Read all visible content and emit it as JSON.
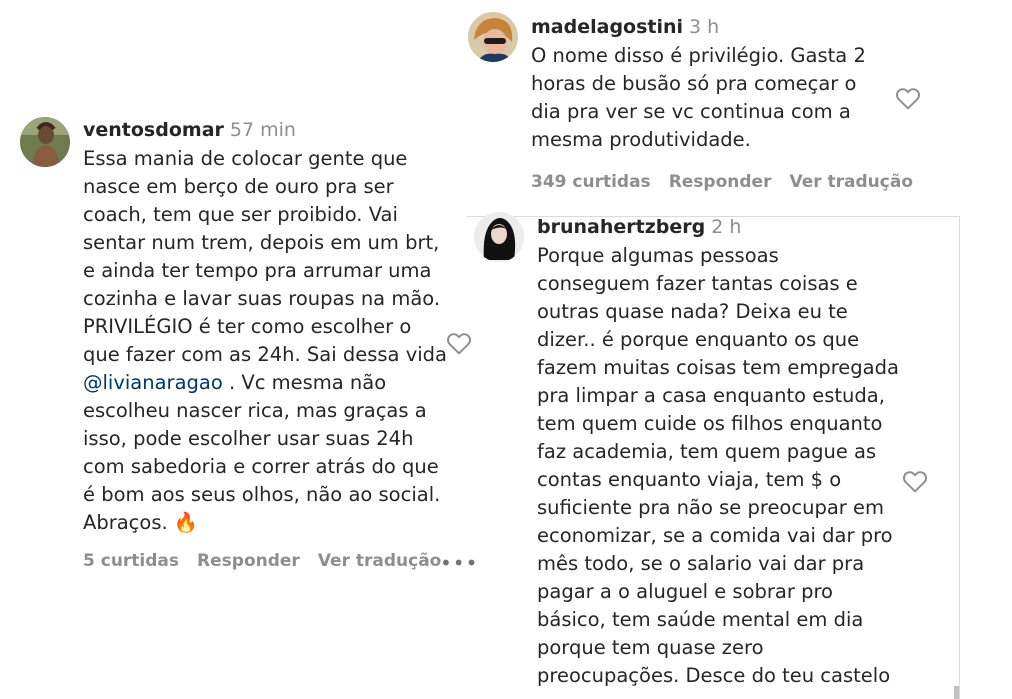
{
  "comments": [
    {
      "username": "ventosdomar",
      "time": "57 min",
      "text_before": "Essa mania de colocar gente que\nnasce em berço de ouro pra ser\ncoach, tem que ser proibido. Vai\nsentar num trem, depois em um brt,\ne ainda ter tempo pra arrumar uma\ncozinha e lavar suas roupas na mão.\nPRIVILÉGIO é ter como escolher o\nque fazer com as 24h. Sai dessa vida\n",
      "mention": "@livianaragao",
      "text_after": " . Vc mesma não\nescolheu nascer rica, mas graças a\nisso, pode escolher usar suas 24h\ncom sabedoria e correr atrás do que\né bom aos seus olhos, não ao social.\nAbraços. 🔥",
      "likes": "5 curtidas",
      "reply": "Responder",
      "translate": "Ver tradução",
      "more": "•••"
    },
    {
      "username": "madelagostini",
      "time": "3 h",
      "text": "O nome disso é privilégio. Gasta 2\nhoras de busão só pra começar o\ndia pra ver se vc continua com a\nmesma produtividade.",
      "likes": "349 curtidas",
      "reply": "Responder",
      "translate": "Ver tradução"
    },
    {
      "username": "brunahertzberg",
      "time": "2 h",
      "text": "Porque algumas pessoas\nconseguem fazer tantas coisas e\noutras quase nada? Deixa eu te\ndizer.. é porque enquanto os que\nfazem muitas coisas tem empregada\npra limpar a casa enquanto estuda,\ntem quem cuide os filhos enquanto\nfaz academia, tem quem pague as\ncontas enquanto viaja, tem $ o\nsuficiente pra não se preocupar em\neconomizar, se a comida vai dar pro\nmês todo, se o salario vai dar pra\npagar a o aluguel e sobrar pro\nbásico, tem saúde mental em dia\nporque tem quase zero\npreocupações. Desce do teu castelo"
    }
  ],
  "icons": {
    "like": "heart-icon",
    "more": "more-options-icon"
  },
  "colors": {
    "mention": "#00376b",
    "muted": "#8e8e8e",
    "text": "#262626"
  }
}
